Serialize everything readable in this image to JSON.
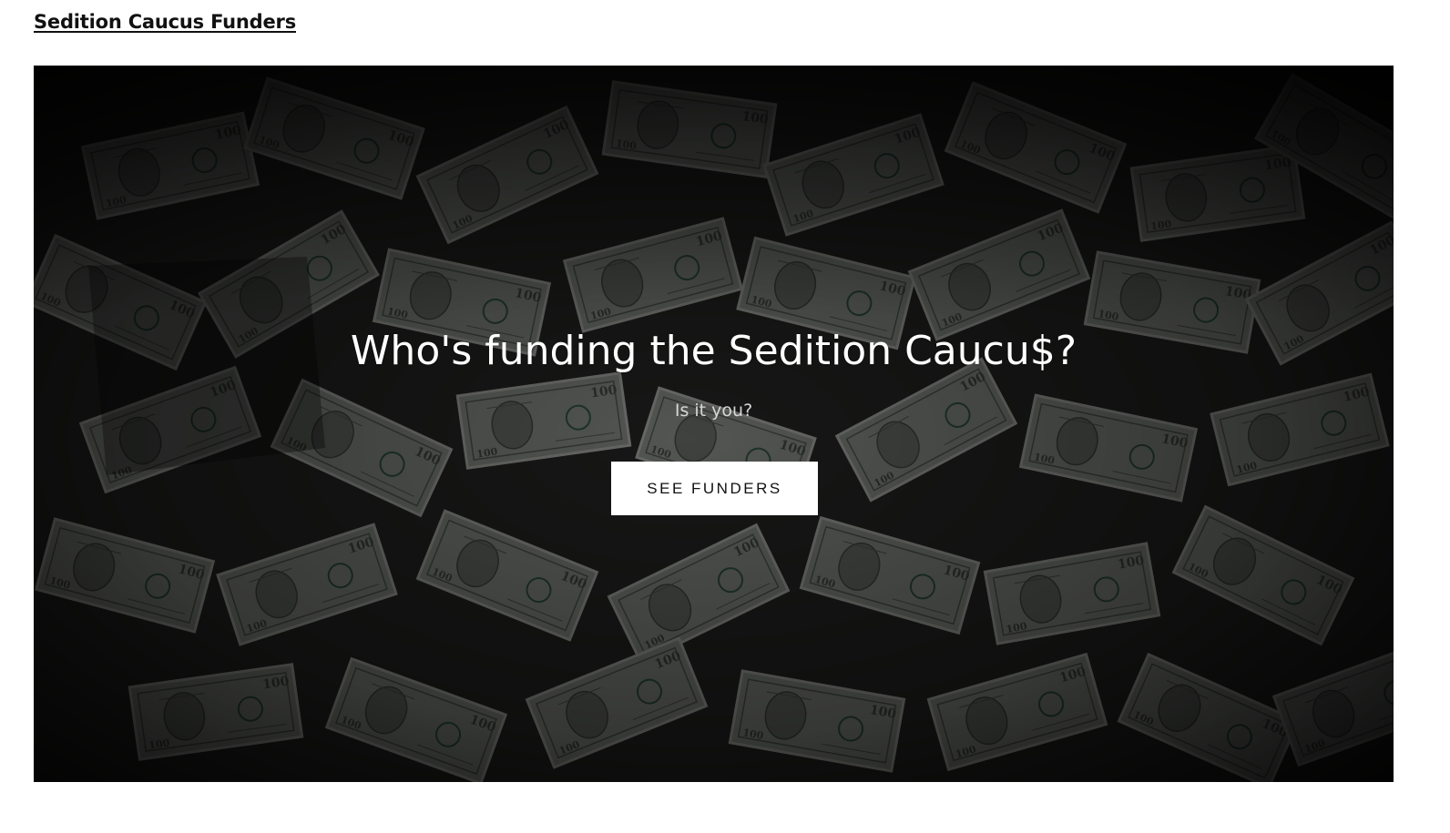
{
  "header": {
    "site_title": "Sedition Caucus Funders"
  },
  "hero": {
    "background_image": "pile-of-hundred-dollar-bills",
    "title": "Who's funding the Sedition Caucu$?",
    "subtitle": "Is it you?",
    "cta_label": "SEE FUNDERS"
  },
  "colors": {
    "page_background": "#ffffff",
    "hero_overlay": "#000000",
    "button_background": "#ffffff",
    "button_text": "#111111",
    "title_text": "#ffffff"
  }
}
